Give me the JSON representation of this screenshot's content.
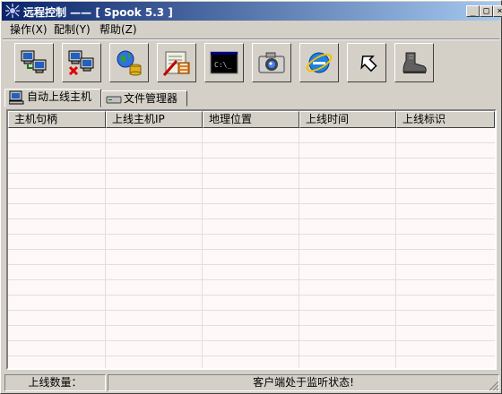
{
  "window": {
    "title": "远程控制 —— [ Spook 5.3 ]"
  },
  "title_buttons": {
    "minimize": "_",
    "maximize": "□",
    "close": "×"
  },
  "menu": [
    "操作(X)",
    "配制(Y)",
    "帮助(Z)"
  ],
  "toolbar": [
    {
      "icon": "connect-computers-icon"
    },
    {
      "icon": "disconnect-computers-icon"
    },
    {
      "icon": "globe-server-icon"
    },
    {
      "icon": "settings-tools-icon"
    },
    {
      "icon": "command-prompt-icon"
    },
    {
      "icon": "camera-icon"
    },
    {
      "icon": "internet-explorer-icon"
    },
    {
      "icon": "arrow-exit-icon"
    },
    {
      "icon": "boot-icon"
    }
  ],
  "command_prompt_text": "C:\\_",
  "tabs": [
    "自动上线主机",
    "文件管理器"
  ],
  "columns": [
    "主机句柄",
    "上线主机IP",
    "地理位置",
    "上线时间",
    "上线标识"
  ],
  "rows": [],
  "status": {
    "count_label": "上线数量：",
    "message": "客户端处于监听状态!"
  }
}
